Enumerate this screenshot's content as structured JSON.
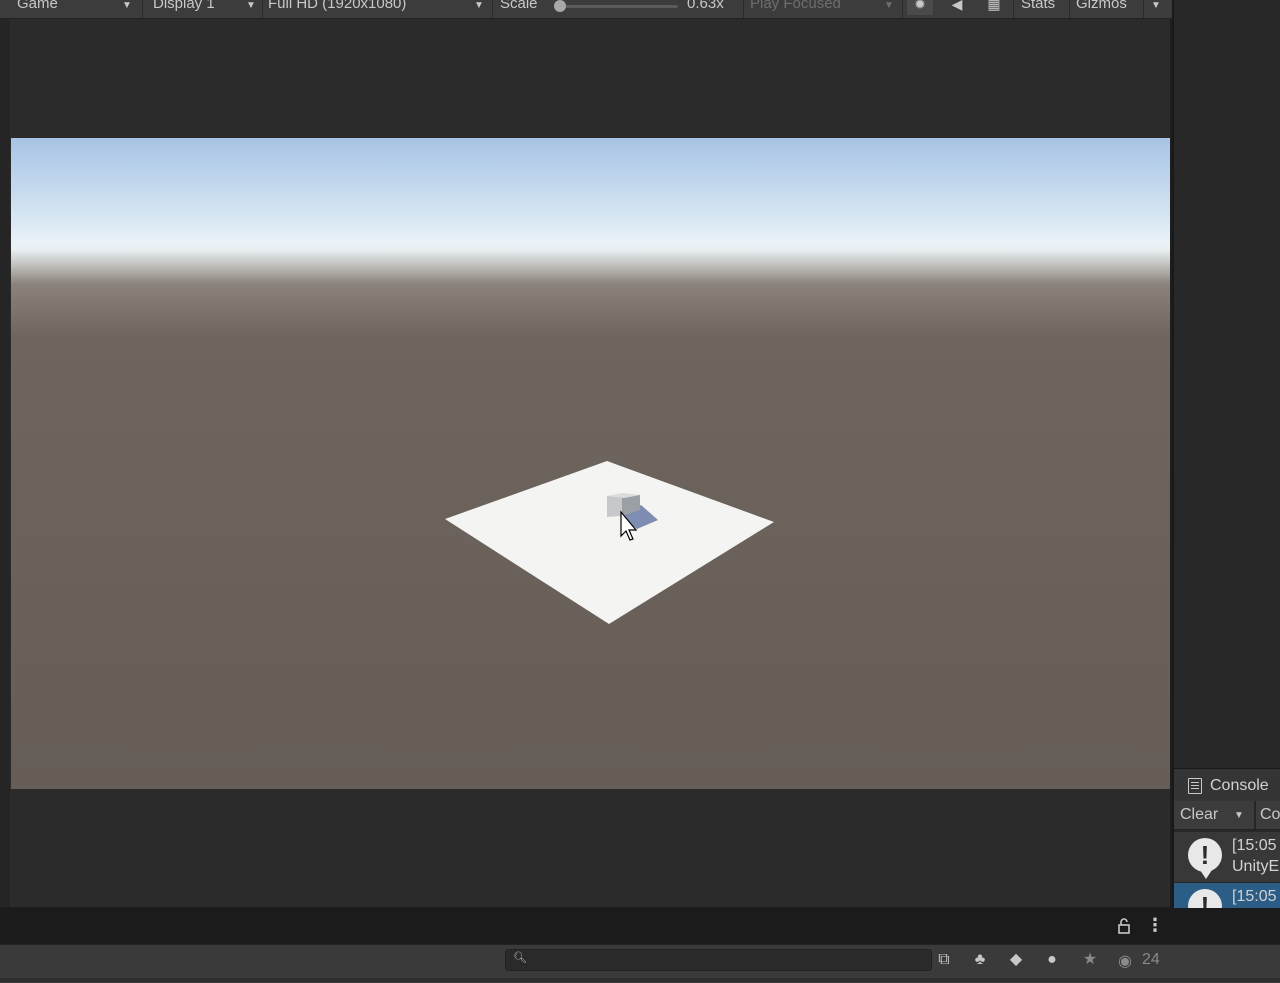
{
  "toolbar": {
    "view_label": "Game",
    "display_label": "Display 1",
    "resolution_label": "Full HD (1920x1080)",
    "scale_label": "Scale",
    "scale_value": "0.63x",
    "scale_fraction": 0.0,
    "play_mode_label": "Play Focused",
    "stats_label": "Stats",
    "gizmos_label": "Gizmos"
  },
  "console": {
    "tab_label": "Console",
    "clear_label": "Clear",
    "collapse_label": "Co",
    "entries": [
      {
        "line1": "[15:05",
        "line2": "UnityE"
      },
      {
        "line1": "[15:05",
        "line2": ""
      }
    ]
  },
  "status_bar": {
    "search_placeholder": "",
    "count": "24"
  },
  "colors": {
    "selected_entry": "#2c5d87",
    "ground": "#665d57",
    "sky_top": "#a7c3e4"
  }
}
